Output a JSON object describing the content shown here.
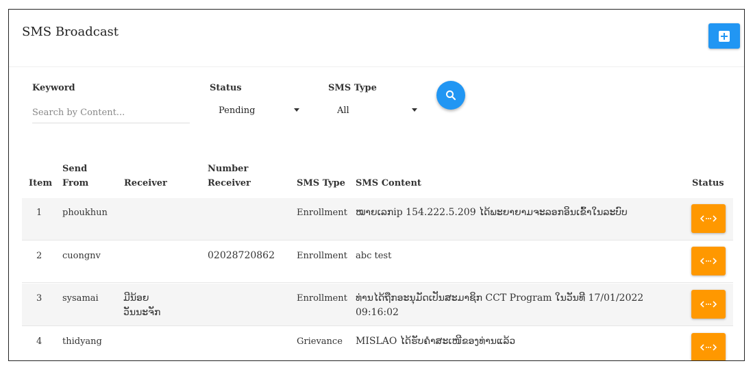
{
  "page": {
    "title": "SMS Broadcast"
  },
  "header": {
    "add_icon": "plus-square-icon"
  },
  "filters": {
    "keyword_label": "Keyword",
    "keyword_placeholder": "Search by Content...",
    "keyword_value": "",
    "status_label": "Status",
    "status_value": "Pending",
    "sms_type_label": "SMS Type",
    "sms_type_value": "All",
    "search_icon": "search-icon"
  },
  "table": {
    "headers": {
      "item": "Item",
      "send_from_1": "Send",
      "send_from_2": "From",
      "receiver": "Receiver",
      "number_receiver_1": "Number",
      "number_receiver_2": "Receiver",
      "sms_type": "SMS Type",
      "sms_content": "SMS Content",
      "status": "Status"
    },
    "rows": [
      {
        "item": "1",
        "send_from": "phoukhun",
        "receiver_1": "",
        "receiver_2": "",
        "number_receiver": "",
        "sms_type": "Enrollment",
        "content_1": "ໝາຍເລກip 154.222.5.209 ໄດ້ພະຍາຍາມຈະລອກອິນເຂົ້າໃນລະບົບ",
        "content_2": "",
        "status_icon": "code-arrows-icon"
      },
      {
        "item": "2",
        "send_from": "cuongnv",
        "receiver_1": "",
        "receiver_2": "",
        "number_receiver": "02028720862",
        "sms_type": "Enrollment",
        "content_1": "abc test",
        "content_2": "",
        "status_icon": "code-arrows-icon"
      },
      {
        "item": "3",
        "send_from": "sysamai",
        "receiver_1": "ມີນ້ອຍ",
        "receiver_2": "ວັນນະຈັກ",
        "number_receiver": "",
        "sms_type": "Enrollment",
        "content_1": "ທ່ານໄດ້ຖືກອະນຸມັດເປັນສະມາຊິກ CCT Program ໃນວັນທີ 17/01/2022",
        "content_2": "09:16:02",
        "status_icon": "code-arrows-icon"
      },
      {
        "item": "4",
        "send_from": "thidyang",
        "receiver_1": "",
        "receiver_2": "",
        "number_receiver": "",
        "sms_type": "Grievance",
        "content_1": "MISLAO ໄດ້ຮັບຄຳສະເໜີຂອງທ່ານແລ້ວ",
        "content_2": "",
        "status_icon": "code-arrows-icon"
      }
    ]
  },
  "colors": {
    "primary": "#2196f3",
    "warning": "#ff9800",
    "row_alt": "#f5f5f5"
  }
}
